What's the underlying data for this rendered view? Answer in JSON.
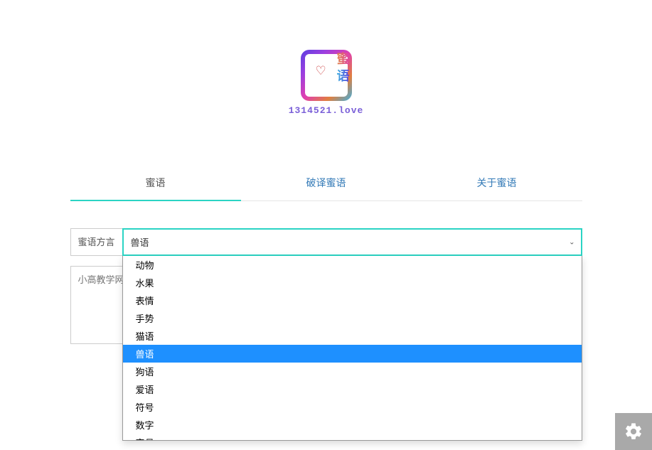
{
  "logo": {
    "char1": "蜜",
    "char2": "语",
    "url": "1314521.love"
  },
  "tabs": [
    {
      "label": "蜜语",
      "active": true
    },
    {
      "label": "破译蜜语",
      "active": false
    },
    {
      "label": "关于蜜语",
      "active": false
    }
  ],
  "dialect": {
    "label": "蜜语方言",
    "selected": "兽语",
    "options": [
      "动物",
      "水果",
      "表情",
      "手势",
      "猫语",
      "兽语",
      "狗语",
      "爱语",
      "符号",
      "数字",
      "字母"
    ]
  },
  "textarea": {
    "placeholder": "小高教学网"
  },
  "colors": {
    "accent": "#2bd4c4",
    "highlight": "#1e90ff",
    "link": "#337ab7"
  }
}
